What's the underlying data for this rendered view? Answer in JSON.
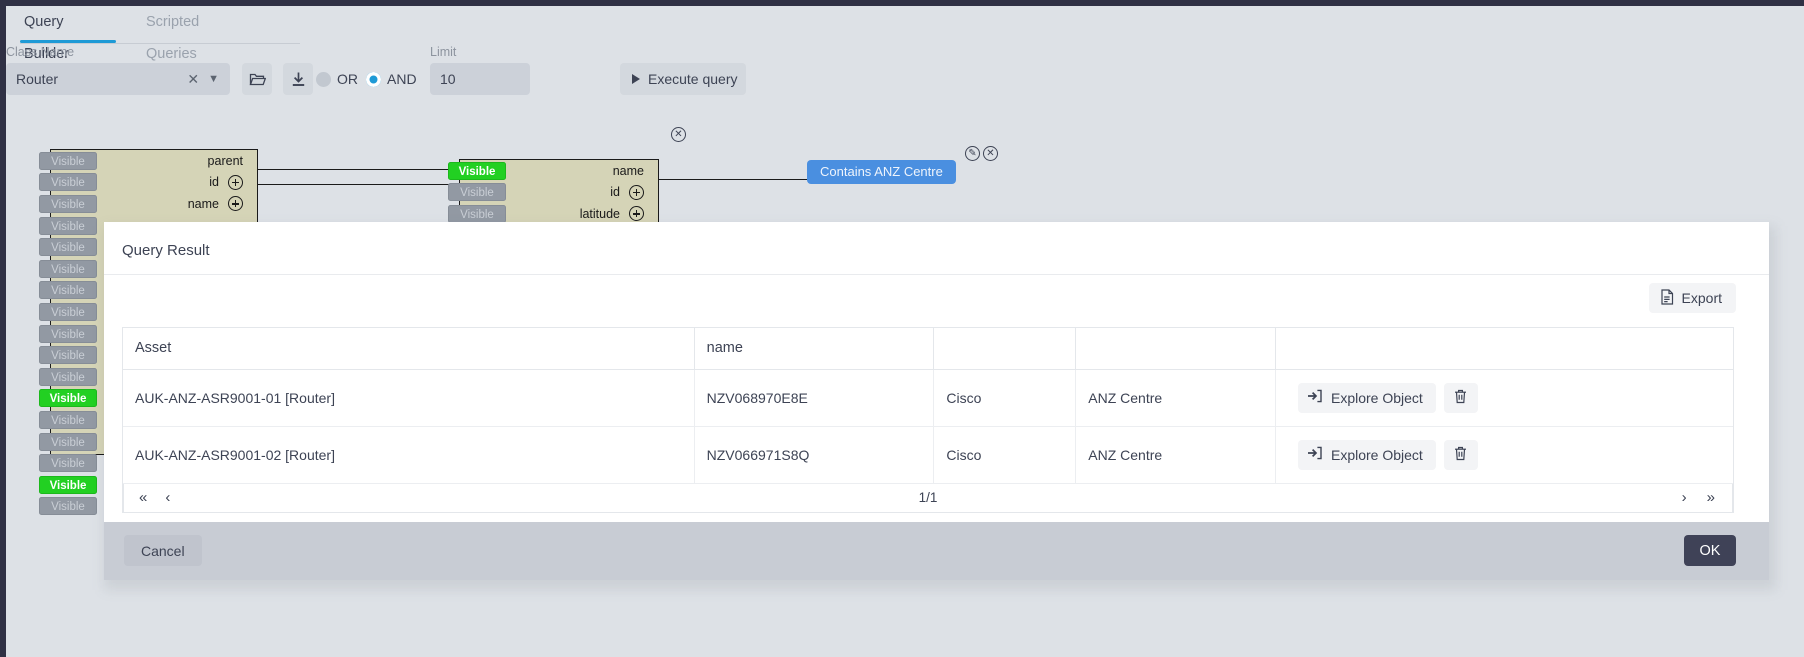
{
  "tabs": [
    {
      "id": "query-builder",
      "label": "Query Builder",
      "active": true
    },
    {
      "id": "scripted-queries",
      "label": "Scripted Queries",
      "active": false
    }
  ],
  "toolbar": {
    "class_name_label": "Class Name",
    "class_name_value": "Router",
    "clear_icon": "close-x-icon",
    "caret_icon": "chevron-down-icon",
    "open_icon": "folder-open-icon",
    "download_icon": "download-icon",
    "operator_or_label": "OR",
    "operator_and_label": "AND",
    "operator_selected": "AND",
    "limit_label": "Limit",
    "limit_value": "10",
    "execute_label": "Execute query"
  },
  "canvas": {
    "node_a": {
      "rows": [
        {
          "chip": "Visible",
          "name": "parent",
          "plus": false,
          "highlight": false
        },
        {
          "chip": "Visible",
          "name": "id",
          "plus": true,
          "highlight": false
        },
        {
          "chip": "Visible",
          "name": "name",
          "plus": true,
          "highlight": false
        },
        {
          "chip": "Visible",
          "name": "",
          "plus": false,
          "highlight": false
        },
        {
          "chip": "Visible",
          "name": "",
          "plus": false,
          "highlight": false
        },
        {
          "chip": "Visible",
          "name": "",
          "plus": false,
          "highlight": false
        },
        {
          "chip": "Visible",
          "name": "",
          "plus": false,
          "highlight": false
        },
        {
          "chip": "Visible",
          "name": "",
          "plus": false,
          "highlight": false
        },
        {
          "chip": "Visible",
          "name": "",
          "plus": false,
          "highlight": false
        },
        {
          "chip": "Visible",
          "name": "",
          "plus": false,
          "highlight": false
        },
        {
          "chip": "Visible",
          "name": "",
          "plus": false,
          "highlight": false
        },
        {
          "chip": "Visible",
          "name": "",
          "plus": false,
          "highlight": true
        },
        {
          "chip": "Visible",
          "name": "",
          "plus": false,
          "highlight": false
        },
        {
          "chip": "Visible",
          "name": "",
          "plus": false,
          "highlight": false
        },
        {
          "chip": "Visible",
          "name": "",
          "plus": false,
          "highlight": false
        },
        {
          "chip": "Visible",
          "name": "",
          "plus": false,
          "highlight": true
        },
        {
          "chip": "Visible",
          "name": "",
          "plus": false,
          "highlight": false
        }
      ]
    },
    "node_b": {
      "close_icon": "close-circle-icon",
      "rows": [
        {
          "chip": "Visible",
          "name": "name",
          "plus": false,
          "highlight": true
        },
        {
          "chip": "Visible",
          "name": "id",
          "plus": true,
          "highlight": false
        },
        {
          "chip": "Visible",
          "name": "latitude",
          "plus": true,
          "highlight": false
        }
      ]
    },
    "relationship_chip": {
      "label": "Contains ANZ Centre",
      "color": "#4a8fe0",
      "edit_icon": "edit-pencil-circle-icon",
      "close_icon": "close-circle-icon"
    }
  },
  "modal": {
    "title": "Query Result",
    "export_label": "Export",
    "export_icon": "document-export-icon",
    "table": {
      "headers": [
        "Asset",
        "name",
        "",
        ""
      ],
      "rows": [
        {
          "asset": "AUK-ANZ-ASR9001-01 [Router]",
          "serial": "NZV068970E8E",
          "vendor": "Cisco",
          "site": "ANZ Centre",
          "explore_label": "Explore Object",
          "explore_icon": "sign-in-arrow-icon",
          "delete_icon": "trash-icon"
        },
        {
          "asset": "AUK-ANZ-ASR9001-02 [Router]",
          "serial": "NZV066971S8Q",
          "vendor": "Cisco",
          "site": "ANZ Centre",
          "explore_label": "Explore Object",
          "explore_icon": "sign-in-arrow-icon",
          "delete_icon": "trash-icon"
        }
      ]
    },
    "pagination": {
      "first_icon": "«",
      "prev_icon": "‹",
      "page_text": "1/1",
      "next_icon": "›",
      "last_icon": "»"
    },
    "footer": {
      "cancel_label": "Cancel",
      "ok_label": "OK"
    }
  },
  "colors": {
    "accent_blue": "#1e9ad6",
    "chip_blue": "#4a8fe0",
    "highlight_green": "#22d022",
    "dark": "#3f4257"
  }
}
